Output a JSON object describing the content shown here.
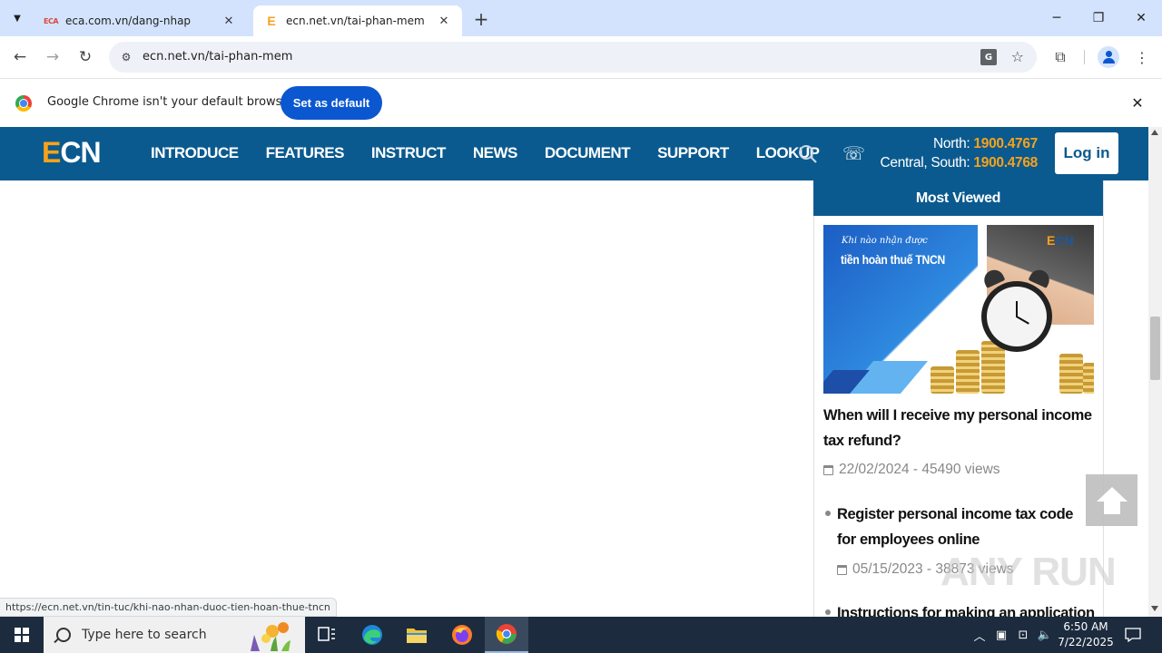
{
  "browser": {
    "tabs": [
      {
        "favicon_text": "ECA",
        "title": "eca.com.vn/dang-nhap",
        "active": false
      },
      {
        "favicon_text": "E",
        "title": "ecn.net.vn/tai-phan-mem",
        "active": true
      }
    ],
    "address": "ecn.net.vn/tai-phan-mem",
    "status_url": "https://ecn.net.vn/tin-tuc/khi-nao-nhan-duoc-tien-hoan-thue-tncn"
  },
  "infobar": {
    "message": "Google Chrome isn't your default browser",
    "button": "Set as default"
  },
  "site": {
    "logo_e": "E",
    "logo_rest": "CN",
    "nav": [
      "INTRODUCE",
      "FEATURES",
      "INSTRUCT",
      "NEWS",
      "DOCUMENT",
      "SUPPORT",
      "LOOKUP"
    ],
    "hotline_north_label": "North: ",
    "hotline_north": "1900.4767",
    "hotline_south_label": "Central, South: ",
    "hotline_south": "1900.4768",
    "login": "Log in",
    "accent": "#f7a21b",
    "brand": "#0a5a8f"
  },
  "most_viewed": {
    "heading": "Most Viewed",
    "thumb_caption_small": "Khi nào nhận được",
    "thumb_caption_big": "tiền hoàn thuế TNCN",
    "thumb_badge_e": "E",
    "thumb_badge_rest": "CN",
    "featured": {
      "title": "When will I receive my personal income tax refund?",
      "meta": "22/02/2024 - 45490 views"
    },
    "items": [
      {
        "title": "Register personal income tax code for employees online",
        "meta": "05/15/2023 - 38873 views"
      },
      {
        "title": "Instructions for making an application",
        "meta": ""
      }
    ]
  },
  "watermark": "ANY RUN",
  "taskbar": {
    "search_placeholder": "Type here to search",
    "time": "6:50 AM",
    "date": "7/22/2025"
  }
}
